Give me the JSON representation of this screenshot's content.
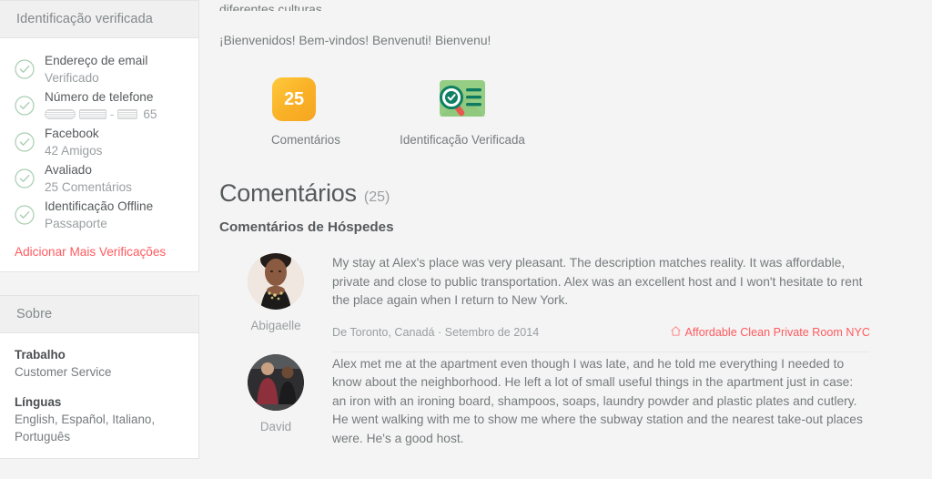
{
  "colors": {
    "accent_red": "#ff5a5f",
    "check_green": "#9ec9a7",
    "badge_orange": "#f5a623",
    "badge_green": "#8dc87e",
    "text_primary": "#565a5c",
    "text_muted": "#9a9fa1",
    "page_bg": "#f4f4f4"
  },
  "sidebar": {
    "verification_panel": {
      "header": "Identificação verificada",
      "items": [
        {
          "title": "Endereço de email",
          "subtitle": "Verificado",
          "icon": "check-circle-icon"
        },
        {
          "title": "Número de telefone",
          "subtitle": "",
          "icon": "check-circle-icon",
          "redacted_phone": true,
          "phone_tail": "65"
        },
        {
          "title": "Facebook",
          "subtitle": "42 Amigos",
          "icon": "check-circle-icon"
        },
        {
          "title": "Avaliado",
          "subtitle": "25 Comentários",
          "icon": "check-circle-icon"
        },
        {
          "title": "Identificação Offline",
          "subtitle": "Passaporte",
          "icon": "check-circle-icon"
        }
      ],
      "add_more_link": "Adicionar Mais Verificações"
    },
    "about_panel": {
      "header": "Sobre",
      "items": [
        {
          "label": "Trabalho",
          "value": "Customer Service"
        },
        {
          "label": "Línguas",
          "value": "English, Español, Italiano, Português"
        }
      ]
    }
  },
  "main": {
    "intro": {
      "cut_line": "diferentes culturas.",
      "welcome_line": "¡Bienvenidos! Bem-vindos! Benvenuti! Bienvenu!"
    },
    "badges": [
      {
        "type": "count",
        "value": "25",
        "label": "Comentários",
        "icon": "review-count-badge-icon"
      },
      {
        "type": "verified",
        "value": "",
        "label": "Identificação Verificada",
        "icon": "verified-id-badge-icon"
      }
    ],
    "reviews_section": {
      "title": "Comentários",
      "count_label": "(25)",
      "subheading": "Comentários de Hóspedes",
      "reviews": [
        {
          "author": "Abigaelle",
          "avatar": "abigaelle-avatar",
          "text": "My stay at Alex's place was very pleasant. The description matches reality. It was affordable, private and close to public transportation. Alex was an excellent host and I won't hesitate to rent the place again when I return to New York.",
          "meta": "De Toronto, Canadá · Setembro de 2014",
          "listing_link": "Affordable Clean Private Room NYC",
          "listing_icon": "home-icon"
        },
        {
          "author": "David",
          "avatar": "david-avatar",
          "text": "Alex met me at the apartment even though I was late, and he told me everything I needed to know about the neighborhood. He left a lot of small useful things in the apartment just in case: an iron with an ironing board, shampoos, soaps, laundry powder and plastic plates and cutlery. He went walking with me to show me where the subway station and the nearest take-out places were. He's a good host.",
          "meta": "",
          "listing_link": "",
          "listing_icon": "home-icon"
        }
      ]
    }
  }
}
